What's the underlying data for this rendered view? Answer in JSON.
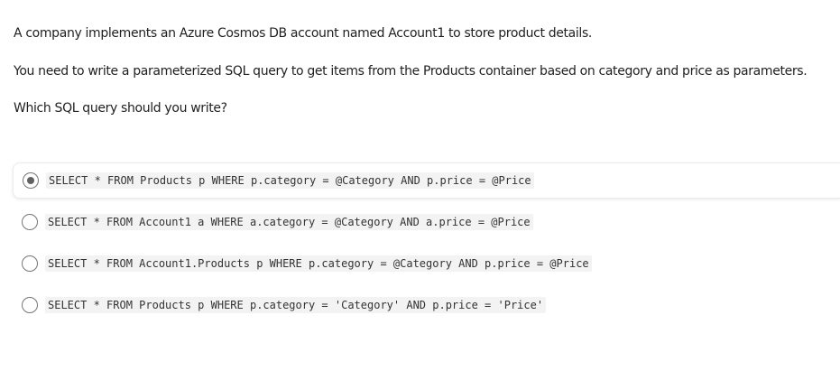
{
  "question": {
    "paragraph_1": "A company implements an Azure Cosmos DB account named Account1 to store product details.",
    "paragraph_2": "You need to write a parameterized SQL query to get items from the Products container based on category and price as parameters.",
    "paragraph_3": "Which SQL query should you write?"
  },
  "options": [
    {
      "text": "SELECT * FROM Products p WHERE p.category = @Category AND p.price = @Price",
      "selected": true
    },
    {
      "text": "SELECT * FROM Account1 a WHERE a.category = @Category AND a.price = @Price",
      "selected": false
    },
    {
      "text": "SELECT * FROM Account1.Products p WHERE p.category = @Category AND p.price = @Price",
      "selected": false
    },
    {
      "text": "SELECT * FROM Products p WHERE p.category = 'Category' AND p.price = 'Price'",
      "selected": false
    }
  ]
}
